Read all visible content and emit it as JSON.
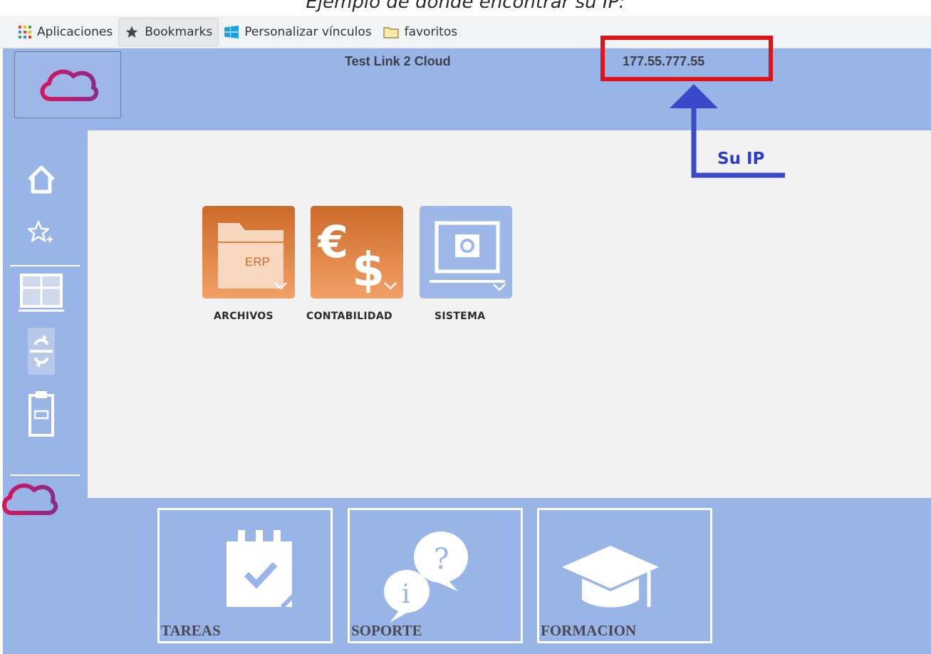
{
  "caption": "Ejemplo de donde encontrar su IP:",
  "bookmarks_bar": {
    "apps_label": "Aplicaciones",
    "bookmarks_label": "Bookmarks",
    "custom_links_label": "Personalizar vínculos",
    "favorites_label": "favoritos"
  },
  "header": {
    "title": "Test Link 2 Cloud",
    "ip": "177.55.777.55"
  },
  "annotation": {
    "label": "Su IP",
    "highlight_color": "#e0121b",
    "arrow_color": "#3a49c9"
  },
  "modules": [
    {
      "label": "ARCHIVOS",
      "icon": "folder-erp-icon",
      "badge": "ERP"
    },
    {
      "label": "CONTABILIDAD",
      "icon": "euro-dollar-icon",
      "badge": "€$"
    },
    {
      "label": "SISTEMA",
      "icon": "monitor-gear-icon"
    }
  ],
  "footer_tiles": [
    {
      "label": "TAREAS",
      "icon": "calendar-check-icon"
    },
    {
      "label": "SOPORTE",
      "icon": "help-bubbles-icon"
    },
    {
      "label": "FORMACION",
      "icon": "graduation-cap-icon"
    }
  ],
  "colors": {
    "app_blue": "#99b4e6",
    "content_bg": "#f2f2f2",
    "orange_tile": "#e0803e",
    "brand_logo": "#b0175e"
  }
}
